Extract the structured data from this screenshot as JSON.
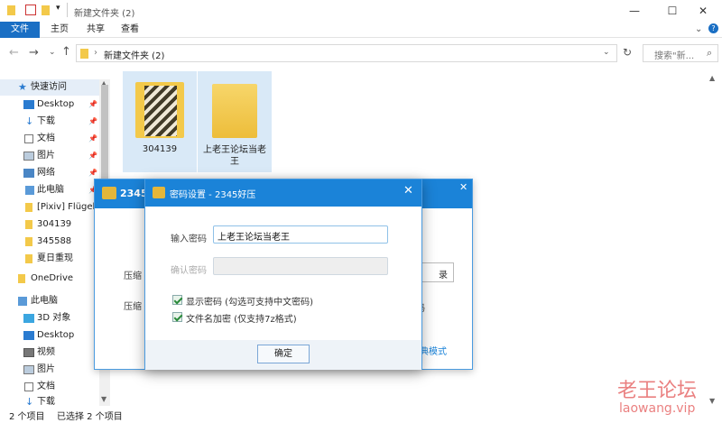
{
  "window": {
    "title": "新建文件夹 (2)"
  },
  "ribbon": {
    "tabs": [
      "文件",
      "主页",
      "共享",
      "查看"
    ]
  },
  "nav": {
    "address": "新建文件夹 (2)",
    "search_placeholder": "搜索\"新..."
  },
  "sidebar": {
    "items": [
      {
        "label": "快速访问",
        "icon": "star-icon"
      },
      {
        "label": "Desktop",
        "icon": "desktop-icon"
      },
      {
        "label": "下载",
        "icon": "download-icon"
      },
      {
        "label": "文档",
        "icon": "document-icon"
      },
      {
        "label": "图片",
        "icon": "picture-icon"
      },
      {
        "label": "网络",
        "icon": "network-icon"
      },
      {
        "label": "此电脑",
        "icon": "computer-icon"
      },
      {
        "label": "[Pixiv] Flügel (",
        "icon": "folder-icon"
      },
      {
        "label": "304139",
        "icon": "folder-icon"
      },
      {
        "label": "345588",
        "icon": "folder-icon"
      },
      {
        "label": "夏日重现",
        "icon": "folder-icon"
      },
      {
        "label": "OneDrive",
        "icon": "onedrive-icon"
      },
      {
        "label": "此电脑",
        "icon": "computer-icon"
      },
      {
        "label": "3D 对象",
        "icon": "cube-icon"
      },
      {
        "label": "Desktop",
        "icon": "desktop-icon"
      },
      {
        "label": "视频",
        "icon": "video-icon"
      },
      {
        "label": "图片",
        "icon": "picture-icon"
      },
      {
        "label": "文档",
        "icon": "document-icon"
      },
      {
        "label": "下载",
        "icon": "download-icon"
      }
    ]
  },
  "files": [
    {
      "name": "304139"
    },
    {
      "name": "上老王论坛当老王"
    }
  ],
  "status": {
    "count": "2 个项目",
    "selected": "已选择 2 个项目"
  },
  "app_back": {
    "title": "2345",
    "left_label_1": "压缩",
    "left_label_2": "压缩",
    "right_btn": "录",
    "right_text": "码",
    "link": "经典模式"
  },
  "dialog": {
    "title": "密码设置 - 2345好压",
    "password_label": "输入密码",
    "password_value": "上老王论坛当老王",
    "confirm_label": "确认密码",
    "show_password": "显示密码 (勾选可支持中文密码)",
    "encrypt_names": "文件名加密 (仅支持7z格式)",
    "ok": "确定"
  },
  "watermark": {
    "line1": "老王论坛",
    "line2": "laowang.vip"
  },
  "colors": {
    "accent": "#1b83d8",
    "selected": "#d9e9f7"
  }
}
